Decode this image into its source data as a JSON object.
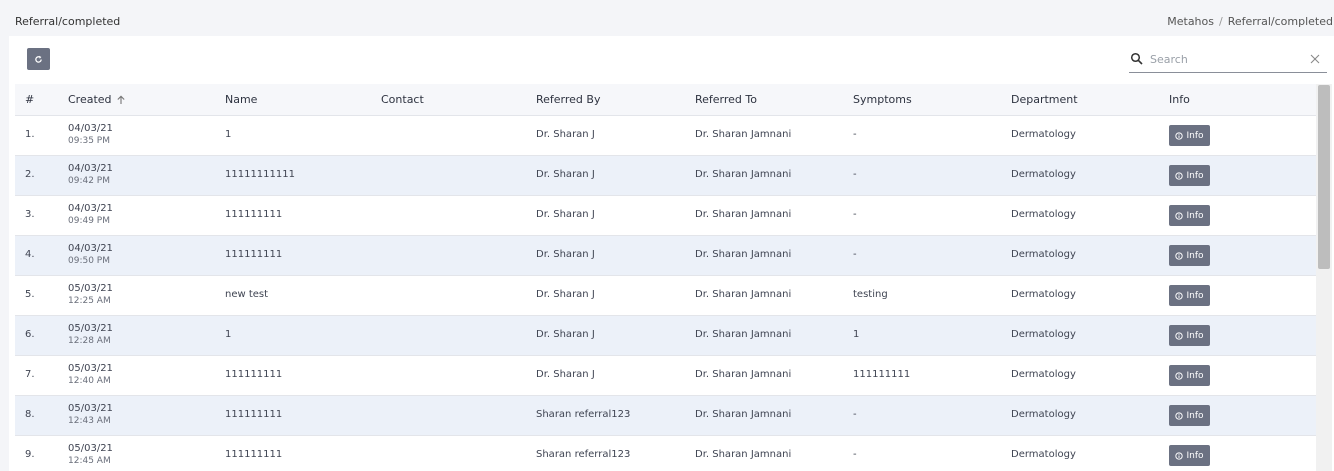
{
  "page": {
    "title": "Referral/completed"
  },
  "breadcrumb": {
    "root": "Metahos",
    "separator": "/",
    "current": "Referral/completed"
  },
  "search": {
    "placeholder": "Search",
    "value": ""
  },
  "table": {
    "headers": {
      "num": "#",
      "created": "Created",
      "name": "Name",
      "contact": "Contact",
      "referred_by": "Referred By",
      "referred_to": "Referred To",
      "symptoms": "Symptoms",
      "department": "Department",
      "info": "Info"
    },
    "info_label": "Info",
    "rows": [
      {
        "num": "1.",
        "date": "04/03/21",
        "time": "09:35 PM",
        "name": "1",
        "contact": "",
        "referred_by": "Dr. Sharan J",
        "referred_to": "Dr. Sharan Jamnani",
        "symptoms": "-",
        "department": "Dermatology"
      },
      {
        "num": "2.",
        "date": "04/03/21",
        "time": "09:42 PM",
        "name": "11111111111",
        "contact": "",
        "referred_by": "Dr. Sharan J",
        "referred_to": "Dr. Sharan Jamnani",
        "symptoms": "-",
        "department": "Dermatology"
      },
      {
        "num": "3.",
        "date": "04/03/21",
        "time": "09:49 PM",
        "name": "111111111",
        "contact": "",
        "referred_by": "Dr. Sharan J",
        "referred_to": "Dr. Sharan Jamnani",
        "symptoms": "-",
        "department": "Dermatology"
      },
      {
        "num": "4.",
        "date": "04/03/21",
        "time": "09:50 PM",
        "name": "111111111",
        "contact": "",
        "referred_by": "Dr. Sharan J",
        "referred_to": "Dr. Sharan Jamnani",
        "symptoms": "-",
        "department": "Dermatology"
      },
      {
        "num": "5.",
        "date": "05/03/21",
        "time": "12:25 AM",
        "name": "new test",
        "contact": "",
        "referred_by": "Dr. Sharan J",
        "referred_to": "Dr. Sharan Jamnani",
        "symptoms": "testing",
        "department": "Dermatology"
      },
      {
        "num": "6.",
        "date": "05/03/21",
        "time": "12:28 AM",
        "name": "1",
        "contact": "",
        "referred_by": "Dr. Sharan J",
        "referred_to": "Dr. Sharan Jamnani",
        "symptoms": "1",
        "department": "Dermatology"
      },
      {
        "num": "7.",
        "date": "05/03/21",
        "time": "12:40 AM",
        "name": "111111111",
        "contact": "",
        "referred_by": "Dr. Sharan J",
        "referred_to": "Dr. Sharan Jamnani",
        "symptoms": "111111111",
        "department": "Dermatology"
      },
      {
        "num": "8.",
        "date": "05/03/21",
        "time": "12:43 AM",
        "name": "111111111",
        "contact": "",
        "referred_by": "Sharan referral123",
        "referred_to": "Dr. Sharan Jamnani",
        "symptoms": "-",
        "department": "Dermatology"
      },
      {
        "num": "9.",
        "date": "05/03/21",
        "time": "12:45 AM",
        "name": "111111111",
        "contact": "",
        "referred_by": "Sharan referral123",
        "referred_to": "Dr. Sharan Jamnani",
        "symptoms": "-",
        "department": "Dermatology"
      }
    ]
  },
  "icons": {
    "refresh": "refresh-icon",
    "search": "search-icon",
    "clear": "close-icon",
    "sort": "arrow-up-icon",
    "info": "info-circle-icon"
  },
  "colors": {
    "button": "#6b7182",
    "alt_row": "#ecf1f9",
    "header_bg": "#f6f7fa"
  }
}
